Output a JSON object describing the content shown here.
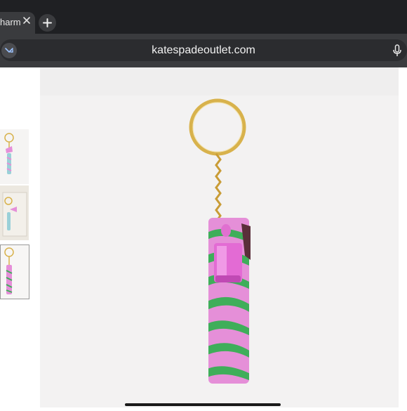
{
  "browser": {
    "tab": {
      "title": "harm",
      "close_icon": "close-icon"
    },
    "new_tab_icon": "plus-icon",
    "address_bar": {
      "url": "katespadeoutlet.com",
      "site_icon": "site-settings-icon",
      "mic_icon": "microphone-icon"
    }
  },
  "product": {
    "main_image": "keychain-pink-green-zebra",
    "thumbnails": [
      {
        "name": "thumbnail-1"
      },
      {
        "name": "thumbnail-2"
      },
      {
        "name": "thumbnail-3",
        "selected": true
      }
    ]
  },
  "colors": {
    "pink": "#e58fd8",
    "green": "#3fae5a",
    "gold": "#d8b24c"
  }
}
